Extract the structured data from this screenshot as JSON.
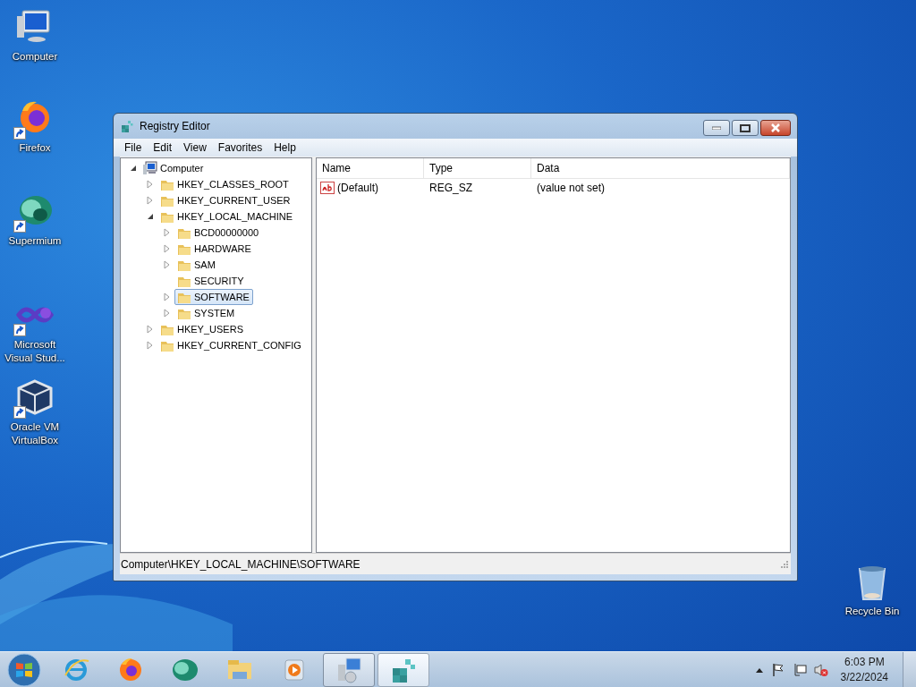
{
  "desktop_icons": [
    {
      "label": "Computer",
      "kind": "computer",
      "shortcut": false
    },
    {
      "label": "Firefox",
      "kind": "firefox",
      "shortcut": true
    },
    {
      "label": "Supermium",
      "kind": "supermium",
      "shortcut": true
    },
    {
      "label": "Microsoft Visual Stud...",
      "kind": "vs",
      "shortcut": true
    },
    {
      "label": "Oracle VM VirtualBox",
      "kind": "vbox",
      "shortcut": true
    },
    {
      "label": "Recycle Bin",
      "kind": "recycle",
      "shortcut": false
    }
  ],
  "window": {
    "title": "Registry Editor",
    "menu": [
      "File",
      "Edit",
      "View",
      "Favorites",
      "Help"
    ],
    "tree": [
      {
        "label": "Computer",
        "kind": "computer",
        "expanded": true,
        "selected": false,
        "children": [
          {
            "label": "HKEY_CLASSES_ROOT",
            "kind": "folder",
            "expanded": false,
            "selected": false
          },
          {
            "label": "HKEY_CURRENT_USER",
            "kind": "folder",
            "expanded": false,
            "selected": false
          },
          {
            "label": "HKEY_LOCAL_MACHINE",
            "kind": "folder",
            "expanded": true,
            "selected": false,
            "children": [
              {
                "label": "BCD00000000",
                "kind": "folder",
                "expanded": false,
                "selected": false
              },
              {
                "label": "HARDWARE",
                "kind": "folder",
                "expanded": false,
                "selected": false
              },
              {
                "label": "SAM",
                "kind": "folder",
                "expanded": false,
                "selected": false
              },
              {
                "label": "SECURITY",
                "kind": "leaf",
                "selected": false
              },
              {
                "label": "SOFTWARE",
                "kind": "folder",
                "expanded": false,
                "selected": true
              },
              {
                "label": "SYSTEM",
                "kind": "folder",
                "expanded": false,
                "selected": false
              }
            ]
          },
          {
            "label": "HKEY_USERS",
            "kind": "folder",
            "expanded": false,
            "selected": false
          },
          {
            "label": "HKEY_CURRENT_CONFIG",
            "kind": "folder",
            "expanded": false,
            "selected": false
          }
        ]
      }
    ],
    "list": {
      "columns": [
        "Name",
        "Type",
        "Data"
      ],
      "rows": [
        {
          "name": "(Default)",
          "type": "REG_SZ",
          "data": "(value not set)"
        }
      ]
    },
    "status_bar": "Computer\\HKEY_LOCAL_MACHINE\\SOFTWARE"
  },
  "taskbar": {
    "pinned": [
      {
        "kind": "ie"
      },
      {
        "kind": "firefox"
      },
      {
        "kind": "supermium"
      },
      {
        "kind": "explorer"
      },
      {
        "kind": "media"
      }
    ],
    "running": [
      {
        "kind": "setup",
        "active": false
      },
      {
        "kind": "regedit",
        "active": true
      }
    ],
    "time": "6:03 PM",
    "date": "3/22/2024"
  }
}
